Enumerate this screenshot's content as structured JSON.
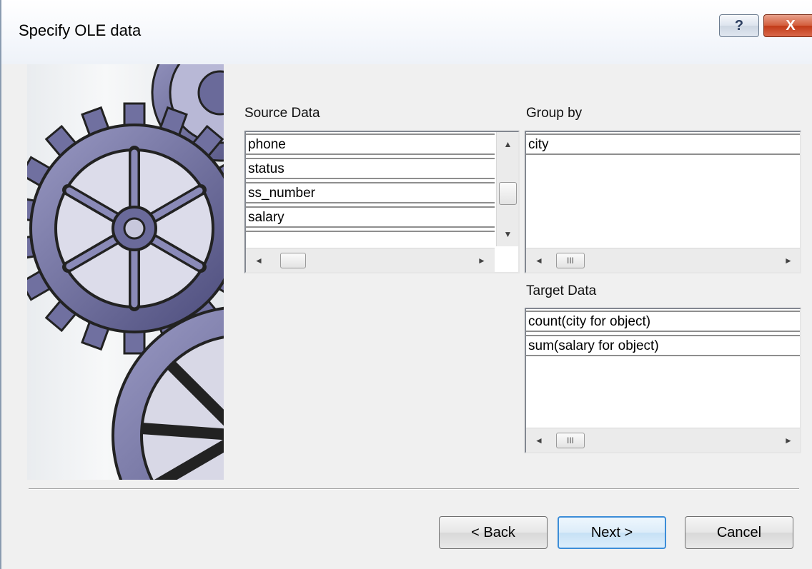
{
  "window": {
    "title": "Specify OLE data",
    "help_glyph": "?",
    "close_glyph": "X"
  },
  "source": {
    "label": "Source Data",
    "items": [
      "phone",
      "status",
      "ss_number",
      "salary"
    ],
    "vscroll": {
      "up_glyph": "▲",
      "down_glyph": "▼"
    },
    "hscroll": {
      "left_glyph": "◄",
      "right_glyph": "►"
    }
  },
  "group_by": {
    "label": "Group by",
    "items": [
      "city"
    ],
    "hscroll": {
      "left_glyph": "◄",
      "right_glyph": "►",
      "grip": "III"
    }
  },
  "target": {
    "label": "Target Data",
    "items": [
      "count(city for object)",
      "sum(salary for object)"
    ],
    "hscroll": {
      "left_glyph": "◄",
      "right_glyph": "►",
      "grip": "III"
    }
  },
  "buttons": {
    "back": "< Back",
    "next": "Next >",
    "cancel": "Cancel"
  },
  "decoration": {
    "art_icon": "gear-illustration-icon",
    "gear_color": "#5a5a8c",
    "accent": "#3c8dd8"
  }
}
